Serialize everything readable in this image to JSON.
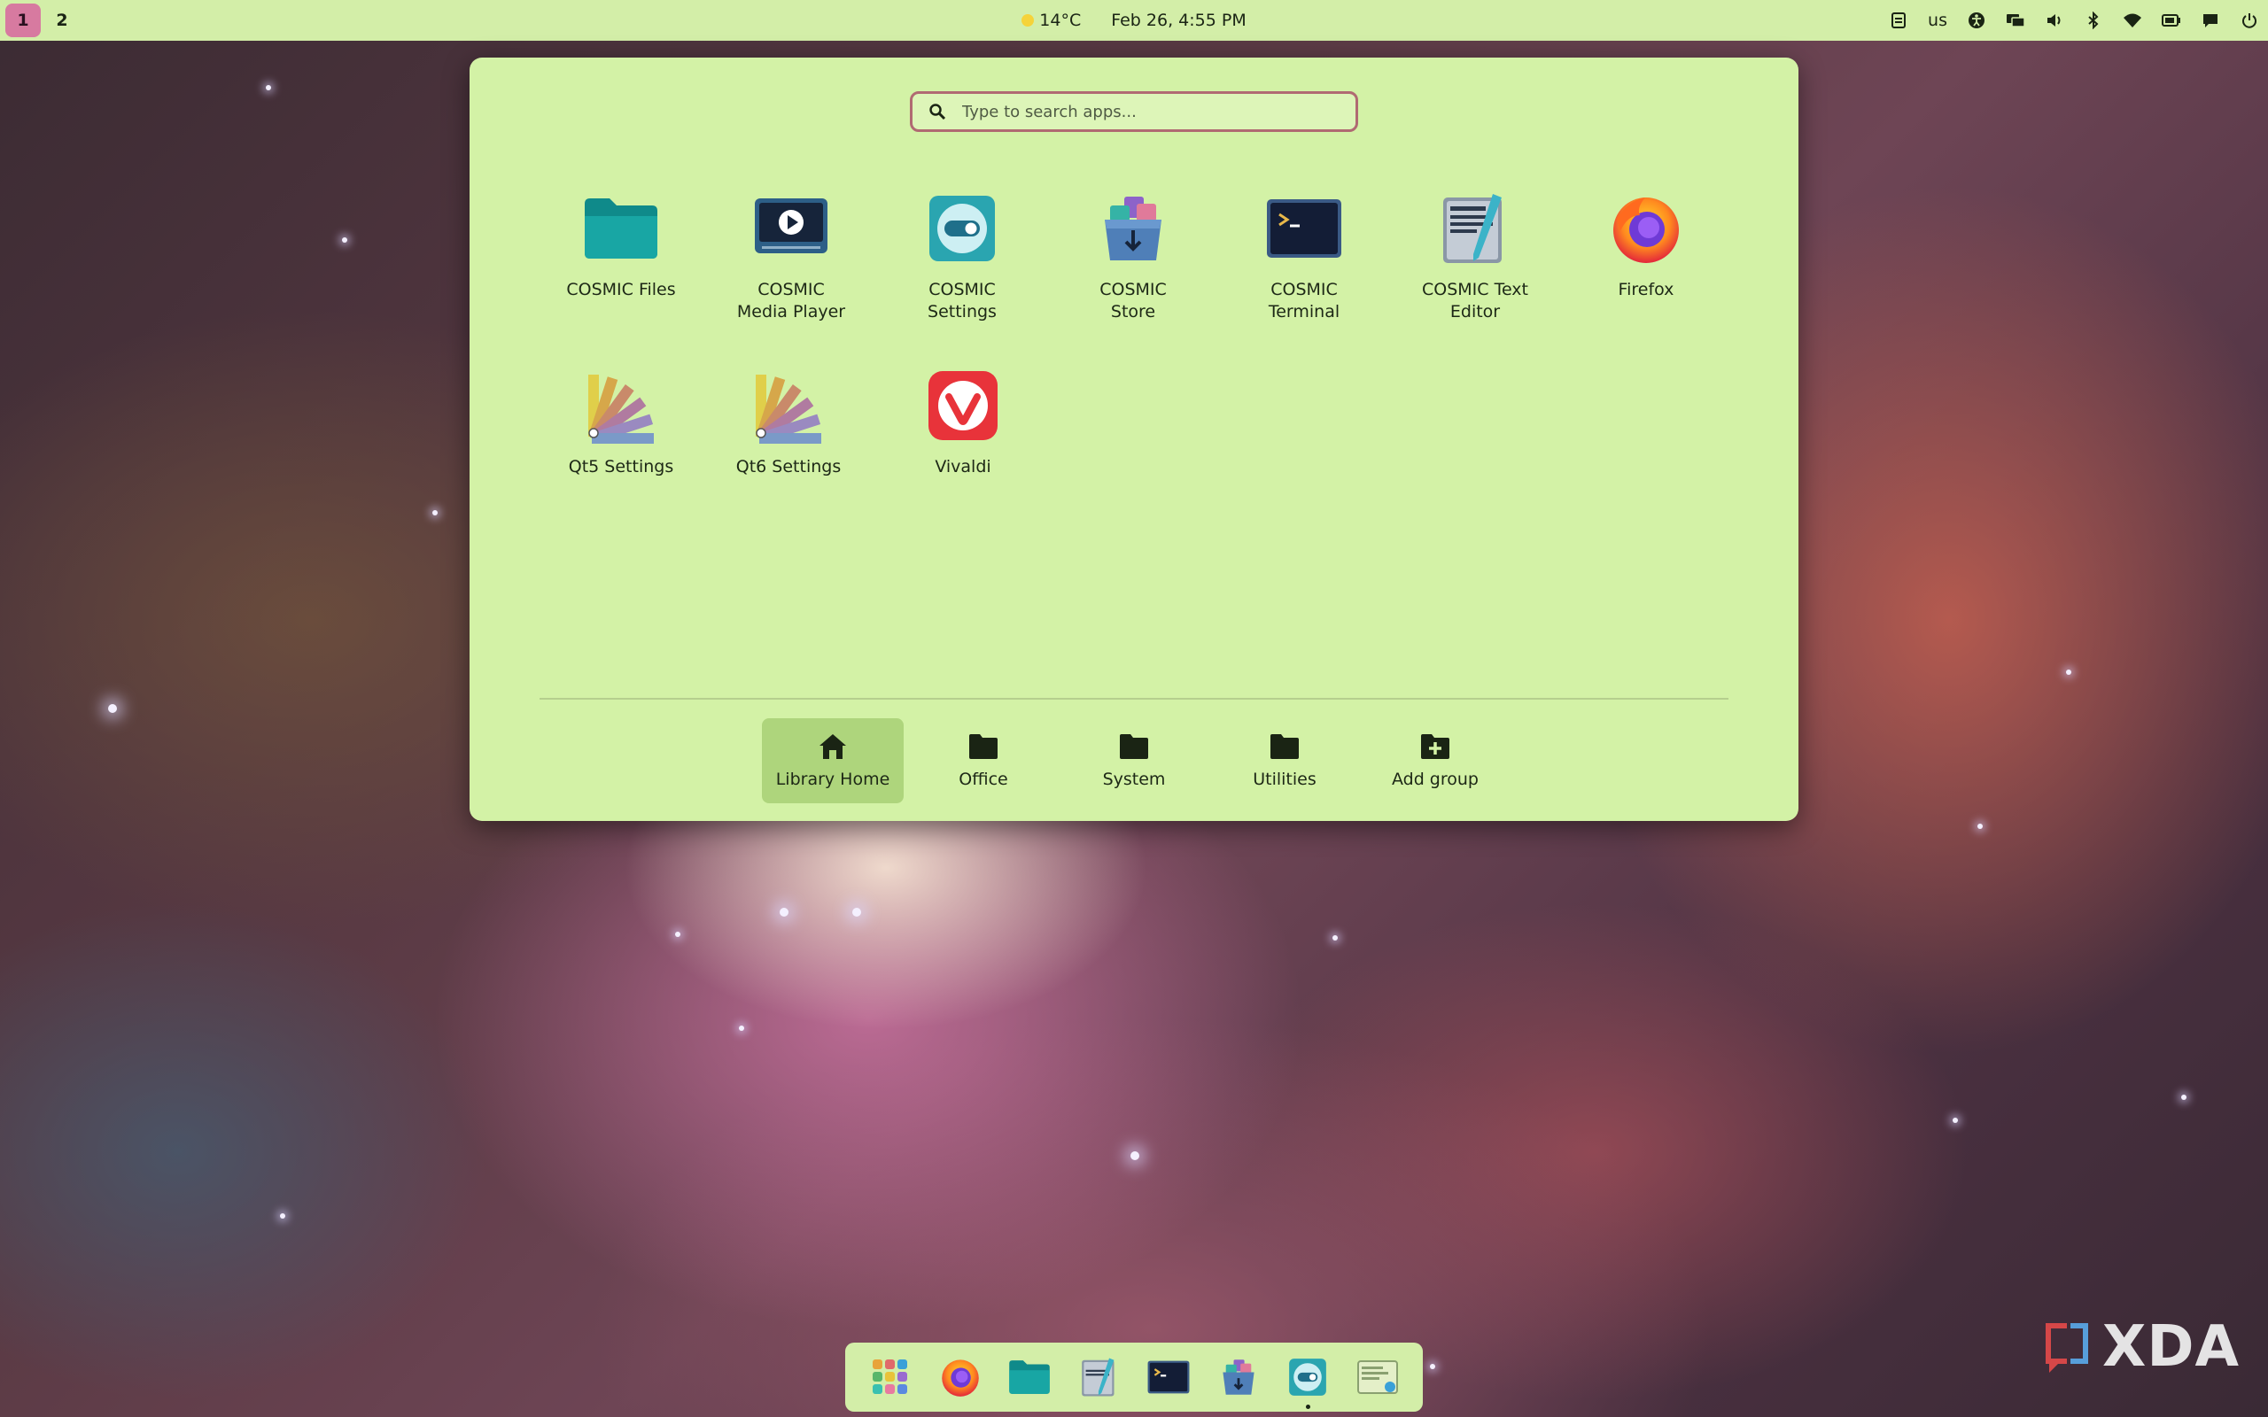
{
  "top_panel": {
    "workspaces": [
      "1",
      "2"
    ],
    "weather": "14°C",
    "datetime": "Feb 26, 4:55 PM",
    "keyboard_layout": "us"
  },
  "launcher": {
    "search_placeholder": "Type to search apps...",
    "apps": [
      {
        "label": "COSMIC Files",
        "icon": "folder-icon"
      },
      {
        "label": "COSMIC Media Player",
        "icon": "media-player-icon"
      },
      {
        "label": "COSMIC Settings",
        "icon": "settings-toggle-icon"
      },
      {
        "label": "COSMIC Store",
        "icon": "store-box-icon"
      },
      {
        "label": "COSMIC Terminal",
        "icon": "terminal-icon"
      },
      {
        "label": "COSMIC Text Editor",
        "icon": "text-editor-icon"
      },
      {
        "label": "Firefox",
        "icon": "firefox-icon"
      },
      {
        "label": "Qt5 Settings",
        "icon": "color-swatch-icon"
      },
      {
        "label": "Qt6 Settings",
        "icon": "color-swatch-icon"
      },
      {
        "label": "Vivaldi",
        "icon": "vivaldi-icon"
      }
    ],
    "groups": [
      {
        "label": "Library Home",
        "icon": "home-icon",
        "active": true
      },
      {
        "label": "Office",
        "icon": "folder-icon"
      },
      {
        "label": "System",
        "icon": "folder-icon"
      },
      {
        "label": "Utilities",
        "icon": "folder-icon"
      },
      {
        "label": "Add group",
        "icon": "folder-add-icon"
      }
    ]
  },
  "dock": {
    "items": [
      "app-library-icon",
      "firefox-icon",
      "files-icon",
      "text-editor-icon",
      "terminal-icon",
      "store-icon",
      "settings-icon",
      "screenshot-icon"
    ]
  },
  "watermark": "XDA",
  "colors": {
    "panel": "#d3eea8",
    "launcher_bg": "#d3f2a6",
    "active_group": "#aed57c",
    "search_border": "#b06a72",
    "workspace_active": "#d77aa0"
  }
}
